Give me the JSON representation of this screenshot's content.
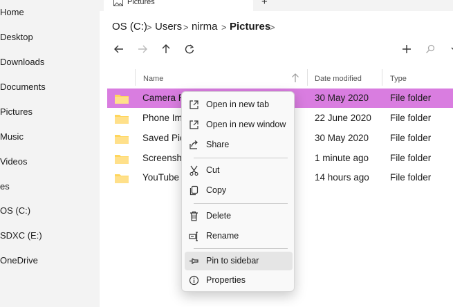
{
  "sidebar": {
    "items": [
      {
        "label": "Home"
      },
      {
        "label": "Desktop"
      },
      {
        "label": "Downloads"
      },
      {
        "label": "Documents"
      },
      {
        "label": "Pictures"
      },
      {
        "label": "Music"
      },
      {
        "label": "Videos"
      },
      {
        "label": "es"
      },
      {
        "label": "OS (C:)"
      },
      {
        "label": "SDXC (E:)"
      },
      {
        "label": "OneDrive"
      }
    ]
  },
  "tabs": {
    "active_label": "Pictures",
    "new_tab_label": "+"
  },
  "breadcrumb": {
    "items": [
      "OS (C:)",
      "Users",
      "nirma",
      "Pictures"
    ],
    "separator": ">"
  },
  "columns": {
    "name": "Name",
    "date": "Date modified",
    "type": "Type"
  },
  "files": [
    {
      "name": "Camera R",
      "date": "30 May 2020",
      "type": "File folder",
      "selected": true
    },
    {
      "name": "Phone Im",
      "date": "22 June 2020",
      "type": "File folder"
    },
    {
      "name": "Saved Pic",
      "date": "30 May 2020",
      "type": "File folder"
    },
    {
      "name": "Screensh",
      "date": "1 minute ago",
      "type": "File folder"
    },
    {
      "name": "YouTube",
      "date": "14 hours ago",
      "type": "File folder"
    }
  ],
  "context_menu": {
    "items": [
      {
        "label": "Open in new tab",
        "icon": "open-new-icon"
      },
      {
        "label": "Open in new window",
        "icon": "open-new-icon"
      },
      {
        "label": "Share",
        "icon": "share-icon"
      },
      {
        "label": "Cut",
        "icon": "scissors-icon"
      },
      {
        "label": "Copy",
        "icon": "copy-icon"
      },
      {
        "label": "Delete",
        "icon": "trash-icon"
      },
      {
        "label": "Rename",
        "icon": "rename-icon"
      },
      {
        "label": "Pin to sidebar",
        "icon": "pin-icon",
        "hovered": true
      },
      {
        "label": "Properties",
        "icon": "info-icon"
      }
    ]
  },
  "colors": {
    "selection": "#d97de0",
    "folder": "#ffd65c",
    "sidebar_bg": "#f3f3f3",
    "menu_hover": "#e5e5e5"
  }
}
